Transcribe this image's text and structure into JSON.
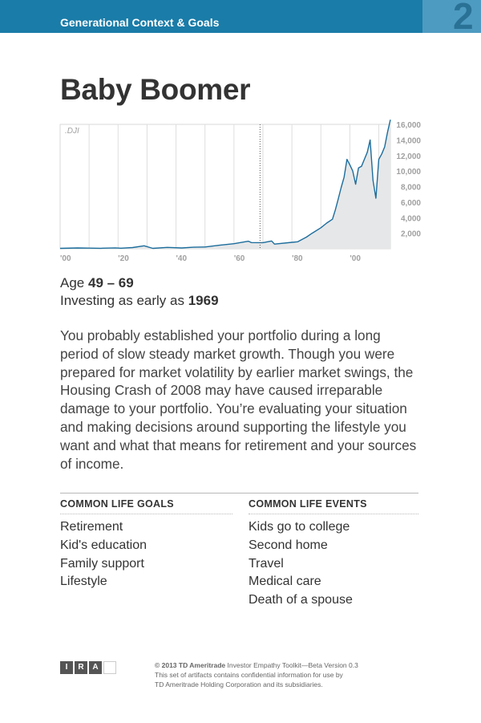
{
  "header": {
    "title": "Generational Context & Goals",
    "number": "2"
  },
  "page_title": "Baby Boomer",
  "chart_data": {
    "type": "area",
    "series_label": ".DJI",
    "x_tick_labels": [
      "'00",
      "'20",
      "'40",
      "'60",
      "'80",
      "'00"
    ],
    "x_ticks": [
      1900,
      1920,
      1940,
      1960,
      1980,
      2000
    ],
    "y_tick_labels": [
      "2,000",
      "4,000",
      "6,000",
      "8,000",
      "10,000",
      "12,000",
      "14,000",
      "16,000"
    ],
    "y_ticks": [
      2000,
      4000,
      6000,
      8000,
      10000,
      12000,
      14000,
      16000
    ],
    "xlim": [
      1900,
      2014
    ],
    "ylim": [
      0,
      16000
    ],
    "marker_year": 1969,
    "grid": true,
    "x": [
      1900,
      1906,
      1910,
      1914,
      1919,
      1921,
      1925,
      1929,
      1932,
      1937,
      1942,
      1946,
      1950,
      1955,
      1960,
      1965,
      1966,
      1970,
      1973,
      1974,
      1980,
      1982,
      1985,
      1987,
      1990,
      1992,
      1994,
      1995,
      1996,
      1997,
      1998,
      1999,
      2000,
      2001,
      2002,
      2003,
      2004,
      2006,
      2007,
      2008,
      2009,
      2010,
      2011,
      2012,
      2013,
      2014
    ],
    "y": [
      50,
      100,
      80,
      60,
      110,
      70,
      150,
      380,
      50,
      180,
      100,
      200,
      230,
      450,
      650,
      970,
      790,
      780,
      1000,
      600,
      830,
      900,
      1500,
      2000,
      2700,
      3300,
      3800,
      5000,
      6400,
      7900,
      9200,
      11500,
      10800,
      10000,
      8300,
      10400,
      10600,
      12400,
      14000,
      8800,
      6500,
      11500,
      12200,
      13100,
      15000,
      16600
    ]
  },
  "age": {
    "prefix": "Age",
    "range": "49 – 69"
  },
  "investing": {
    "prefix": "Investing as early as",
    "year": "1969"
  },
  "description": "You probably established your portfolio during a long period of slow steady market growth. Though you were prepared for market volatility by earlier market swings, the Housing Crash of 2008 may have caused irreparable damage to your portfolio. You’re evaluating your situation and making decisions around supporting the lifestyle you want and what that means for retirement and your sources of income.",
  "goals": {
    "heading": "COMMON LIFE GOALS",
    "items": [
      "Retirement",
      "Kid's education",
      "Family support",
      "Lifestyle"
    ]
  },
  "events": {
    "heading": "COMMON LIFE EVENTS",
    "items": [
      "Kids go to college",
      "Second home",
      "Travel",
      "Medical care",
      "Death of a spouse"
    ]
  },
  "logo_letters": [
    "I",
    "R",
    "A",
    ""
  ],
  "footer": {
    "line1_bold": "© 2013 TD Ameritrade",
    "line1_rest": " Investor Empathy Toolkit—Beta Version 0.3",
    "line2": "This set of artifacts contains confidential information for use by",
    "line3": "TD Ameritrade Holding Corporation and its subsidiaries."
  },
  "colors": {
    "header": "#1a7ca8",
    "number_box": "#4e9bc1",
    "line": "#1c6d9c",
    "area": "#e6e7e8"
  }
}
